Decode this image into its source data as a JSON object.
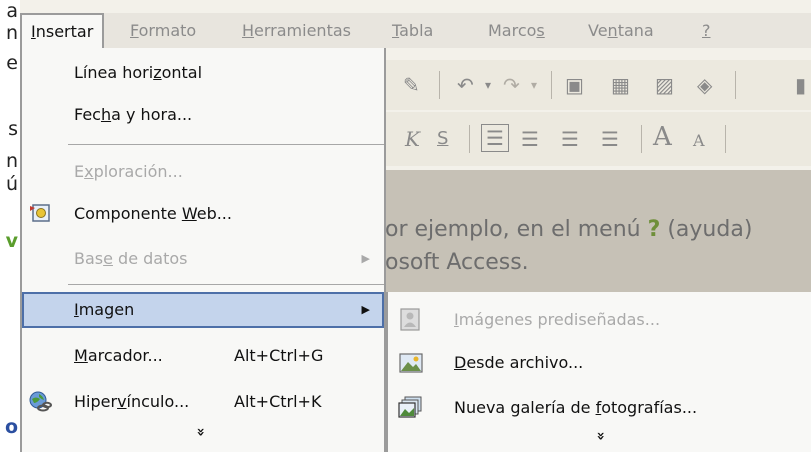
{
  "left_strip_chars": [
    "a",
    "n",
    "e",
    "s",
    "n",
    "ú",
    "v",
    "o"
  ],
  "menubar": {
    "items": [
      {
        "label_pre": "",
        "label_ul": "I",
        "label_post": "nsertar",
        "active": true
      },
      {
        "label_pre": "",
        "label_ul": "F",
        "label_post": "ormato"
      },
      {
        "label_pre": "",
        "label_ul": "H",
        "label_post": "erramientas"
      },
      {
        "label_pre": "",
        "label_ul": "T",
        "label_post": "abla"
      },
      {
        "label_pre": "Marco",
        "label_ul": "s",
        "label_post": ""
      },
      {
        "label_pre": "Ve",
        "label_ul": "n",
        "label_post": "tana"
      },
      {
        "label_pre": "",
        "label_ul": "?",
        "label_post": ""
      }
    ]
  },
  "menu": {
    "items": [
      {
        "pre": "Línea hori",
        "ul": "z",
        "post": "ontal",
        "shortcut": ""
      },
      {
        "pre": "Fec",
        "ul": "h",
        "post": "a y hora...",
        "shortcut": ""
      },
      {
        "pre": "E",
        "ul": "x",
        "post": "ploración...",
        "shortcut": "",
        "disabled": true
      },
      {
        "pre": "Componente ",
        "ul": "W",
        "post": "eb...",
        "shortcut": "",
        "icon": "web-component-icon"
      },
      {
        "pre": "Bas",
        "ul": "e",
        "post": " de datos",
        "shortcut": "",
        "disabled": true,
        "submenu": true
      },
      {
        "pre": "",
        "ul": "I",
        "post": "magen",
        "shortcut": "",
        "submenu": true,
        "highlight": true
      },
      {
        "pre": "",
        "ul": "M",
        "post": "arcador...",
        "shortcut": "Alt+Ctrl+G"
      },
      {
        "pre": "Hiper",
        "ul": "v",
        "post": "ínculo...",
        "shortcut": "Alt+Ctrl+K",
        "icon": "hyperlink-icon"
      }
    ],
    "expand_glyph": "»"
  },
  "submenu": {
    "items": [
      {
        "pre": "",
        "ul": "I",
        "post": "mágenes prediseñadas...",
        "disabled": true,
        "icon": "clipart-icon"
      },
      {
        "pre": "",
        "ul": "D",
        "post": "esde archivo...",
        "icon": "picture-file-icon"
      },
      {
        "pre": "Nueva galería de ",
        "ul": "f",
        "post": "otografías...",
        "icon": "photo-album-icon"
      }
    ],
    "expand_glyph": "»"
  },
  "document": {
    "line1_pre": "or ejemplo, en el menú ",
    "line1_q": "?",
    "line1_post": " (ayuda)",
    "line2": "osoft Access."
  },
  "colors": {
    "highlight_bg": "#c4d4ec",
    "highlight_border": "#4d6fa8",
    "menu_bg": "#f8f8f6",
    "help_q": "#6f8f3a"
  }
}
